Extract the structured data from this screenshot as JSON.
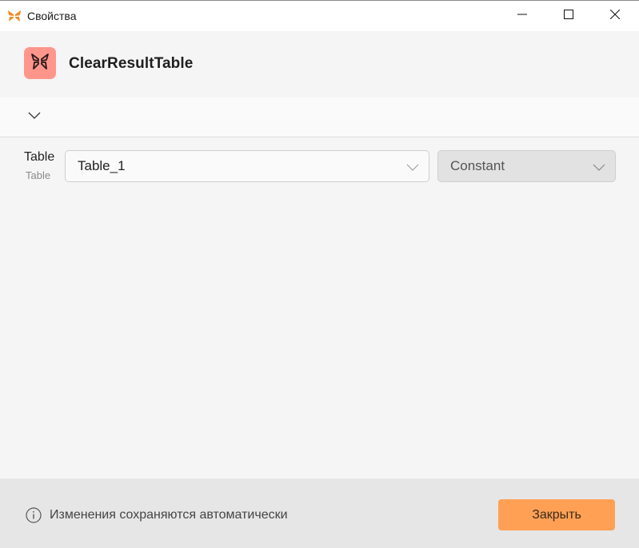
{
  "window": {
    "title": "Свойства",
    "app_icon": "butterfly-logo-icon",
    "controls": {
      "minimize": "minimize-icon",
      "maximize": "maximize-icon",
      "close": "close-icon"
    }
  },
  "header": {
    "node_icon": "butterfly-icon",
    "node_icon_color": "#ff968c",
    "title": "ClearResultTable"
  },
  "collapse": {
    "icon": "chevron-down-icon"
  },
  "properties": [
    {
      "label": "Table",
      "sublabel": "Table",
      "value": "Table_1",
      "mode": "Constant"
    }
  ],
  "footer": {
    "info_icon": "info-icon",
    "info_text": "Изменения сохраняются автоматически",
    "close_label": "Закрыть",
    "close_color": "#ffa055"
  }
}
